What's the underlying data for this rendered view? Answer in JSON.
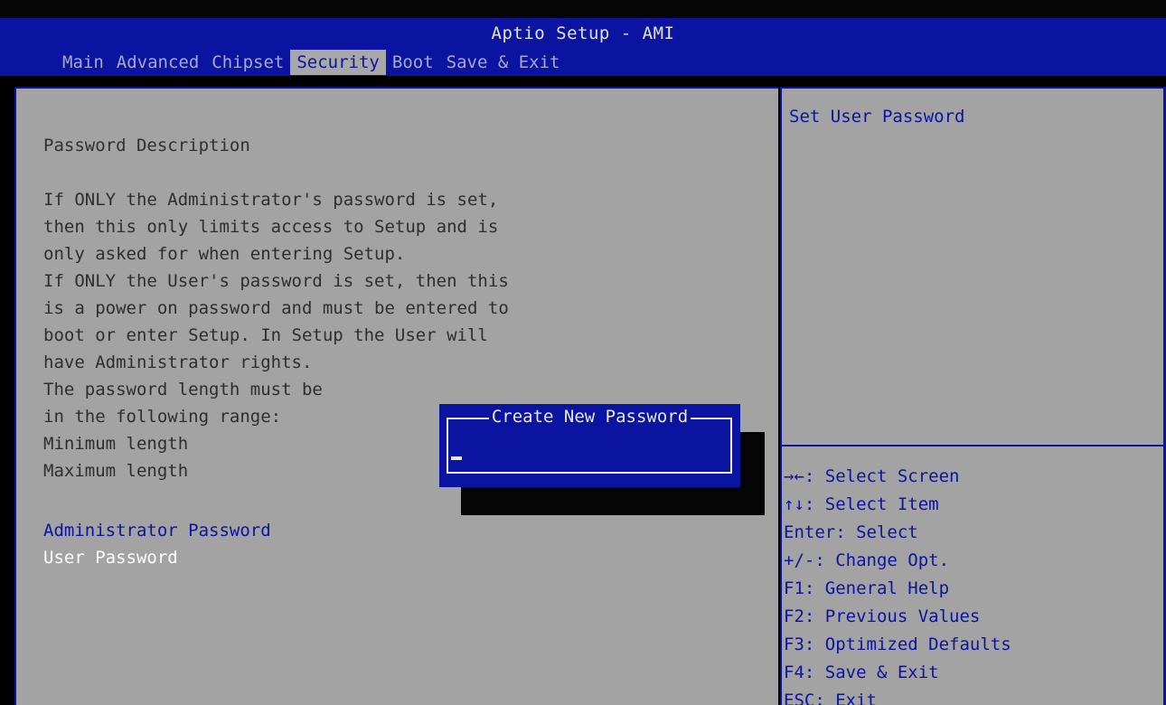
{
  "header": {
    "title": "Aptio Setup - AMI",
    "tabs": [
      {
        "label": "Main"
      },
      {
        "label": "Advanced"
      },
      {
        "label": "Chipset"
      },
      {
        "label": "Security"
      },
      {
        "label": "Boot"
      },
      {
        "label": "Save & Exit"
      }
    ],
    "active_tab": "Security"
  },
  "description": {
    "heading": "Password Description",
    "lines": [
      "If ONLY the Administrator's password is set,",
      "then this only limits access to Setup and is",
      "only asked for when entering Setup.",
      "If ONLY the User's password is set, then this",
      "is a power on password and must be entered to",
      "boot or enter Setup. In Setup the User will",
      "have Administrator rights.",
      "The password length must be",
      "in the following range:",
      "Minimum length",
      "Maximum length"
    ]
  },
  "menu": {
    "admin_password": "Administrator Password",
    "user_password": "User Password"
  },
  "help": {
    "text": "Set User Password"
  },
  "keys": [
    "→←: Select Screen",
    "↑↓: Select Item",
    "Enter: Select",
    "+/-: Change Opt.",
    "F1: General Help",
    "F2: Previous Values",
    "F3: Optimized Defaults",
    "F4: Save & Exit",
    "ESC: Exit"
  ],
  "dialog": {
    "title": "Create New Password",
    "value": ""
  },
  "colors": {
    "bios_blue": "#0a14a0",
    "panel_gray": "#a3a3a3",
    "highlight_white": "#ffffff"
  }
}
